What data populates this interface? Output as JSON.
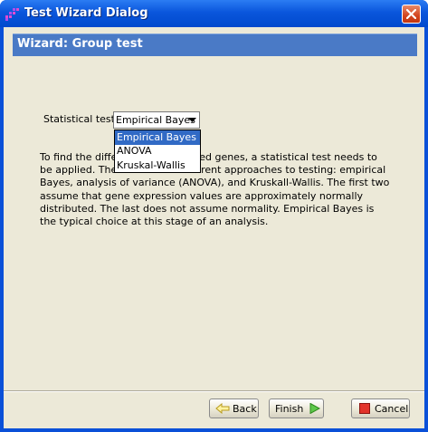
{
  "window": {
    "title": "Test Wizard Dialog"
  },
  "wizard": {
    "header": "Wizard: Group test",
    "test_label": "Statistical test:",
    "selected_test": "Empirical Bayes",
    "options": [
      "Empirical Bayes",
      "ANOVA",
      "Kruskal-Wallis"
    ],
    "description": "To find the differentially expressed genes, a statistical test needs to be applied. There are three different approaches to testing: empirical Bayes, analysis of variance (ANOVA), and Kruskall-Wallis. The first two assume that gene expression values are approximately normally distributed. The last does not assume normality. Empirical Bayes is the typical choice at this stage of an analysis."
  },
  "buttons": {
    "back": "Back",
    "finish": "Finish",
    "cancel": "Cancel"
  },
  "colors": {
    "titlebar": "#0a56dc",
    "header_band": "#4a7ac6",
    "dialog_bg": "#ece9d8",
    "selection": "#316ac5"
  },
  "icons": {
    "app": "grid-logo-icon",
    "close": "close-icon",
    "back": "arrow-left-icon",
    "finish": "arrow-right-icon",
    "cancel": "stop-icon",
    "dropdown": "chevron-down-icon"
  }
}
